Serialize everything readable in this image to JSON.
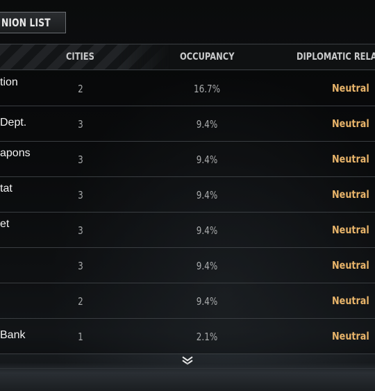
{
  "tab": {
    "label": "NION LIST"
  },
  "table": {
    "headers": {
      "cities": "CITIES",
      "occupancy": "OCCUPANCY",
      "diplomatic": "DIPLOMATIC RELATI"
    },
    "rows": [
      {
        "name": "tion",
        "cities": "2",
        "occupancy": "16.7%",
        "diplomatic": "Neutral"
      },
      {
        "name": " Dept.",
        "cities": "3",
        "occupancy": "9.4%",
        "diplomatic": "Neutral"
      },
      {
        "name": "apons",
        "cities": "3",
        "occupancy": "9.4%",
        "diplomatic": "Neutral"
      },
      {
        "name": "tat",
        "cities": "3",
        "occupancy": "9.4%",
        "diplomatic": "Neutral"
      },
      {
        "name": "et",
        "cities": "3",
        "occupancy": "9.4%",
        "diplomatic": "Neutral"
      },
      {
        "name": "",
        "cities": "3",
        "occupancy": "9.4%",
        "diplomatic": "Neutral"
      },
      {
        "name": "",
        "cities": "2",
        "occupancy": "9.4%",
        "diplomatic": "Neutral"
      },
      {
        "name": "Bank",
        "cities": "1",
        "occupancy": "2.1%",
        "diplomatic": "Neutral"
      }
    ]
  },
  "icons": {
    "scroll": "chevron-down-icon"
  },
  "colors": {
    "neutral": "#e8b46a",
    "text": "#f2f2f2",
    "muted": "#a8aaab"
  }
}
